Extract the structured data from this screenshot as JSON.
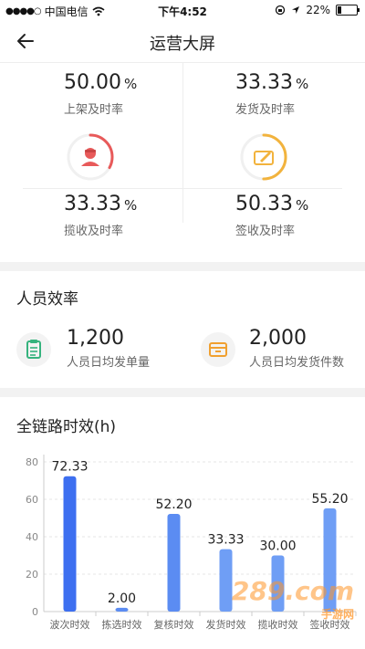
{
  "status": {
    "carrier": "中国电信",
    "time": "下午4:52",
    "battery": "22%",
    "battery_level": 0.22
  },
  "nav": {
    "title": "运营大屏"
  },
  "metrics": [
    {
      "value": "50.00",
      "unit": "%",
      "label": "上架及时率"
    },
    {
      "value": "33.33",
      "unit": "%",
      "label": "发货及时率"
    },
    {
      "value": "33.33",
      "unit": "%",
      "label": "揽收及时率",
      "ring_level": 0.33,
      "color": "#e85a5a",
      "icon": "courier-icon"
    },
    {
      "value": "50.33",
      "unit": "%",
      "label": "签收及时率",
      "ring_level": 0.5,
      "color": "#f2b33d",
      "icon": "sign-edit-icon"
    }
  ],
  "efficiency": {
    "title": "人员效率",
    "items": [
      {
        "value": "1,200",
        "label": "人员日均发单量",
        "icon": "clipboard-icon",
        "color": "#36b37e"
      },
      {
        "value": "2,000",
        "label": "人员日均发货件数",
        "icon": "box-icon",
        "color": "#f0a030"
      }
    ]
  },
  "chart": {
    "title": "全链路时效(h)",
    "watermark": "289.com",
    "watermark_sub": "手游网"
  },
  "chart_data": {
    "type": "bar",
    "title": "全链路时效(h)",
    "categories": [
      "波次时效",
      "拣选时效",
      "复核时效",
      "发货时效",
      "揽收时效",
      "签收时效"
    ],
    "values": [
      72.33,
      2.0,
      52.2,
      33.33,
      30.0,
      55.2
    ],
    "value_labels": [
      "72.33",
      "2.00",
      "52.20",
      "33.33",
      "30.00",
      "55.20"
    ],
    "ylim": [
      0,
      80
    ],
    "yticks": [
      "0",
      "20",
      "40",
      "60",
      "80"
    ],
    "grid": true,
    "bar_colors": [
      "#3d6ff0",
      "#5b8cf2",
      "#5b8cf2",
      "#6f9ef5",
      "#6f9ef5",
      "#6f9ef5"
    ]
  }
}
